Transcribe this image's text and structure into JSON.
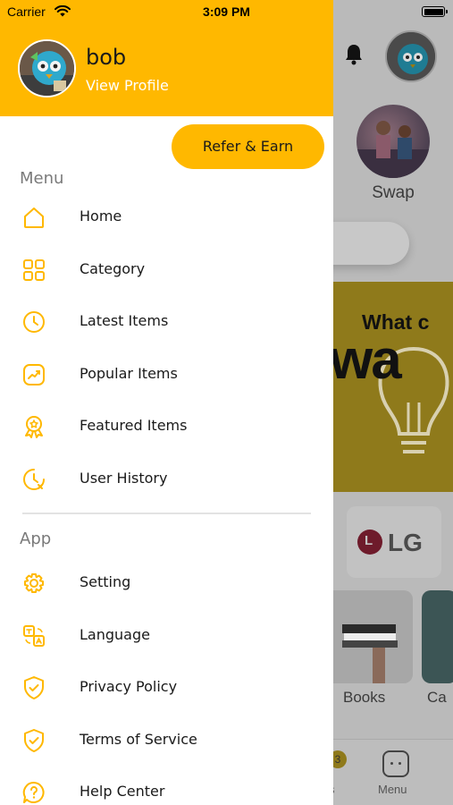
{
  "status_bar": {
    "carrier": "Carrier",
    "time": "3:09 PM"
  },
  "background": {
    "swap_label": "Swap",
    "banner_line1": "What c",
    "banner_line2": "wa",
    "brand_logo_text": "LG",
    "books_label": "Books",
    "camera_label": "Ca",
    "tab_badge": "3",
    "tab_partial": "s",
    "tab_menu_label": "Menu"
  },
  "drawer": {
    "profile": {
      "name": "bob",
      "link": "View Profile"
    },
    "refer_button": "Refer & Earn",
    "menu_section": {
      "title": "Menu",
      "items": [
        {
          "label": "Home",
          "icon": "home-icon"
        },
        {
          "label": "Category",
          "icon": "category-icon"
        },
        {
          "label": "Latest Items",
          "icon": "clock-icon"
        },
        {
          "label": "Popular Items",
          "icon": "trending-icon"
        },
        {
          "label": "Featured Items",
          "icon": "award-icon"
        },
        {
          "label": "User History",
          "icon": "history-icon"
        }
      ]
    },
    "app_section": {
      "title": "App",
      "items": [
        {
          "label": "Setting",
          "icon": "gear-icon"
        },
        {
          "label": "Language",
          "icon": "translate-icon"
        },
        {
          "label": "Privacy Policy",
          "icon": "shield-check-icon"
        },
        {
          "label": "Terms of Service",
          "icon": "shield-check-icon"
        },
        {
          "label": "Help Center",
          "icon": "help-icon"
        }
      ]
    }
  },
  "colors": {
    "accent": "#ffb800",
    "drawer_bg": "#ffffff",
    "dim_overlay": "#bababa"
  }
}
